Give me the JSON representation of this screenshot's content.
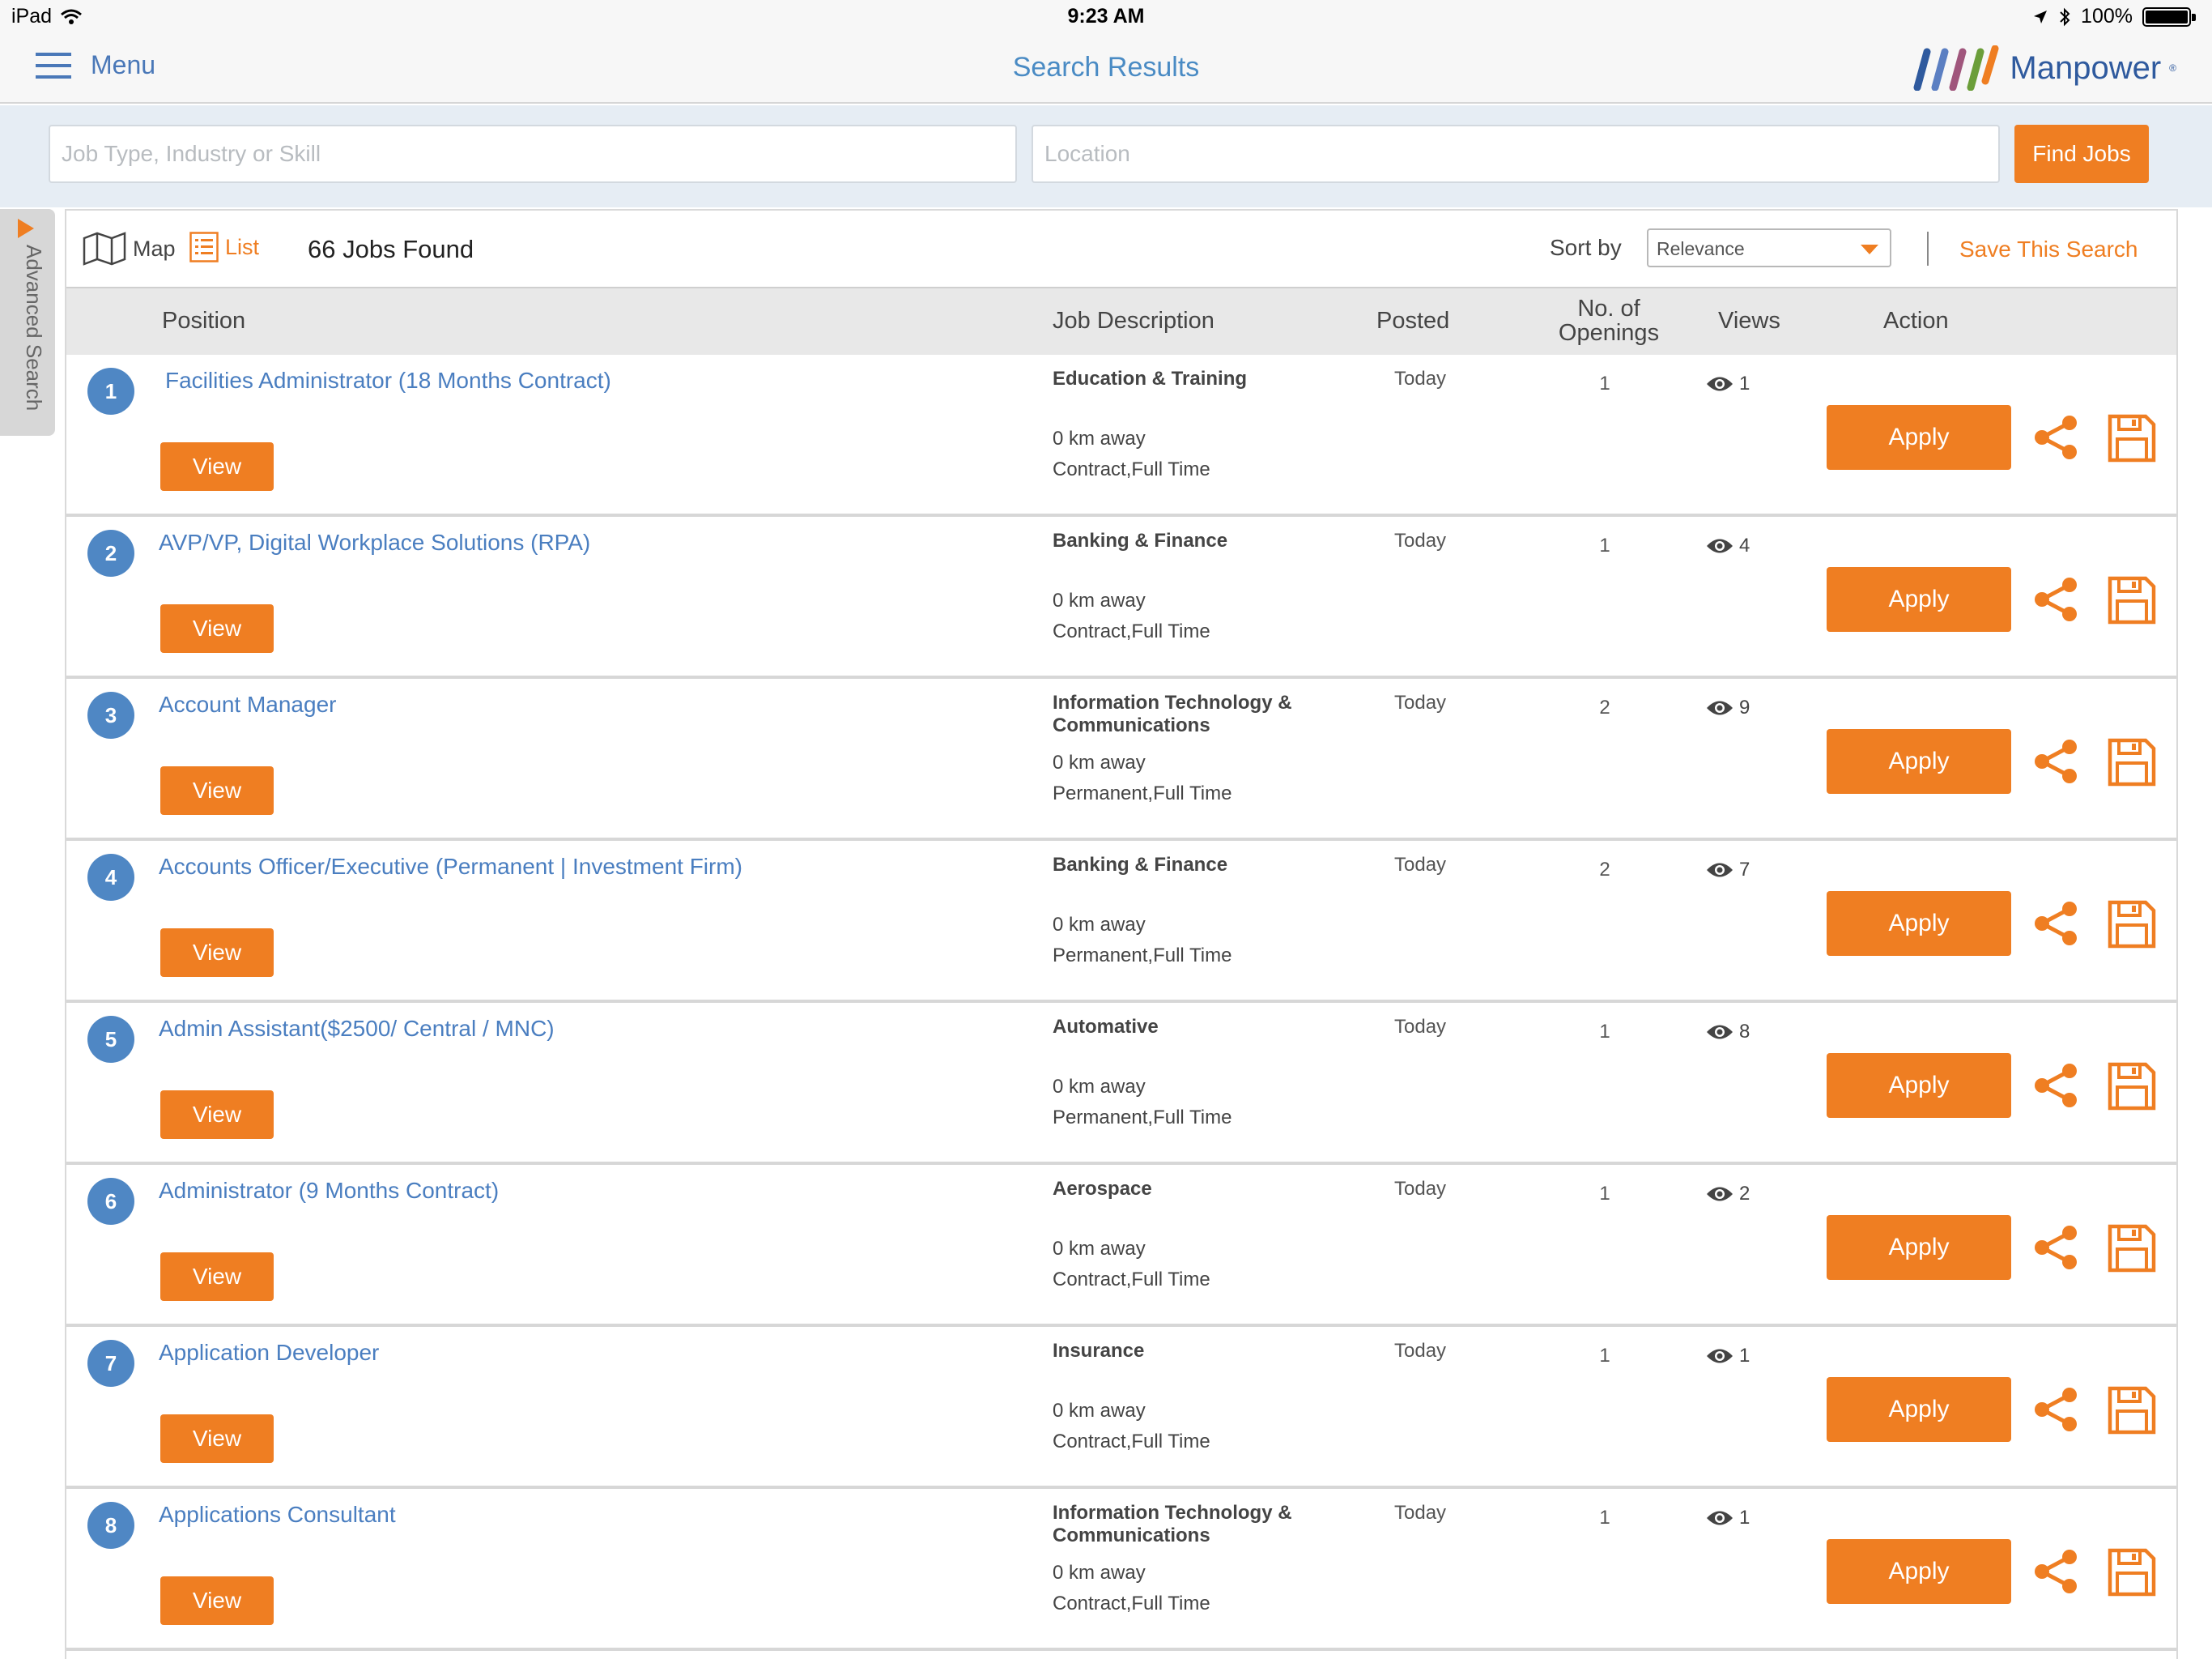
{
  "status_bar": {
    "device": "iPad",
    "time": "9:23 AM",
    "battery": "100%"
  },
  "header": {
    "menu_label": "Menu",
    "title": "Search Results",
    "brand": "Manpower",
    "brand_mark": "®"
  },
  "search": {
    "job_placeholder": "Job Type, Industry or Skill",
    "location_placeholder": "Location",
    "find_label": "Find Jobs"
  },
  "advanced_search_label": "Advanced Search",
  "toolbar": {
    "map_label": "Map",
    "list_label": "List",
    "jobs_found": "66 Jobs Found",
    "sort_label": "Sort by",
    "sort_value": "Relevance",
    "save_search_label": "Save This Search"
  },
  "columns": {
    "position": "Position",
    "description": "Job Description",
    "posted": "Posted",
    "openings_line1": "No. of",
    "openings_line2": "Openings",
    "views": "Views",
    "action": "Action"
  },
  "colors": {
    "accent": "#ef7e22",
    "link": "#4a7ec0",
    "badge": "#4f87c4"
  },
  "jobs": [
    {
      "num": "1",
      "title": "Facilities Administrator (18 Months Contract)",
      "category": "Education & Training",
      "distance": "0 km away",
      "type": "Contract,Full Time",
      "posted": "Today",
      "openings": "1",
      "views": "1",
      "view_label": "View",
      "apply_label": "Apply"
    },
    {
      "num": "2",
      "title": "AVP/VP, Digital Workplace Solutions (RPA)",
      "category": "Banking & Finance",
      "distance": "0 km away",
      "type": "Contract,Full Time",
      "posted": "Today",
      "openings": "1",
      "views": "4",
      "view_label": "View",
      "apply_label": "Apply"
    },
    {
      "num": "3",
      "title": "Account Manager",
      "category": "Information Technology & Communications",
      "distance": "0 km away",
      "type": "Permanent,Full Time",
      "posted": "Today",
      "openings": "2",
      "views": "9",
      "view_label": "View",
      "apply_label": "Apply"
    },
    {
      "num": "4",
      "title": "Accounts Officer/Executive (Permanent | Investment Firm)",
      "category": "Banking & Finance",
      "distance": "0 km away",
      "type": "Permanent,Full Time",
      "posted": "Today",
      "openings": "2",
      "views": "7",
      "view_label": "View",
      "apply_label": "Apply"
    },
    {
      "num": "5",
      "title": "Admin Assistant($2500/ Central / MNC)",
      "category": "Automative",
      "distance": "0 km away",
      "type": "Permanent,Full Time",
      "posted": "Today",
      "openings": "1",
      "views": "8",
      "view_label": "View",
      "apply_label": "Apply"
    },
    {
      "num": "6",
      "title": "Administrator (9 Months Contract)",
      "category": "Aerospace",
      "distance": "0 km away",
      "type": "Contract,Full Time",
      "posted": "Today",
      "openings": "1",
      "views": "2",
      "view_label": "View",
      "apply_label": "Apply"
    },
    {
      "num": "7",
      "title": "Application Developer",
      "category": "Insurance",
      "distance": "0 km away",
      "type": "Contract,Full Time",
      "posted": "Today",
      "openings": "1",
      "views": "1",
      "view_label": "View",
      "apply_label": "Apply"
    },
    {
      "num": "8",
      "title": "Applications Consultant",
      "category": "Information Technology & Communications",
      "distance": "0 km away",
      "type": "Contract,Full Time",
      "posted": "Today",
      "openings": "1",
      "views": "1",
      "view_label": "View",
      "apply_label": "Apply"
    }
  ]
}
